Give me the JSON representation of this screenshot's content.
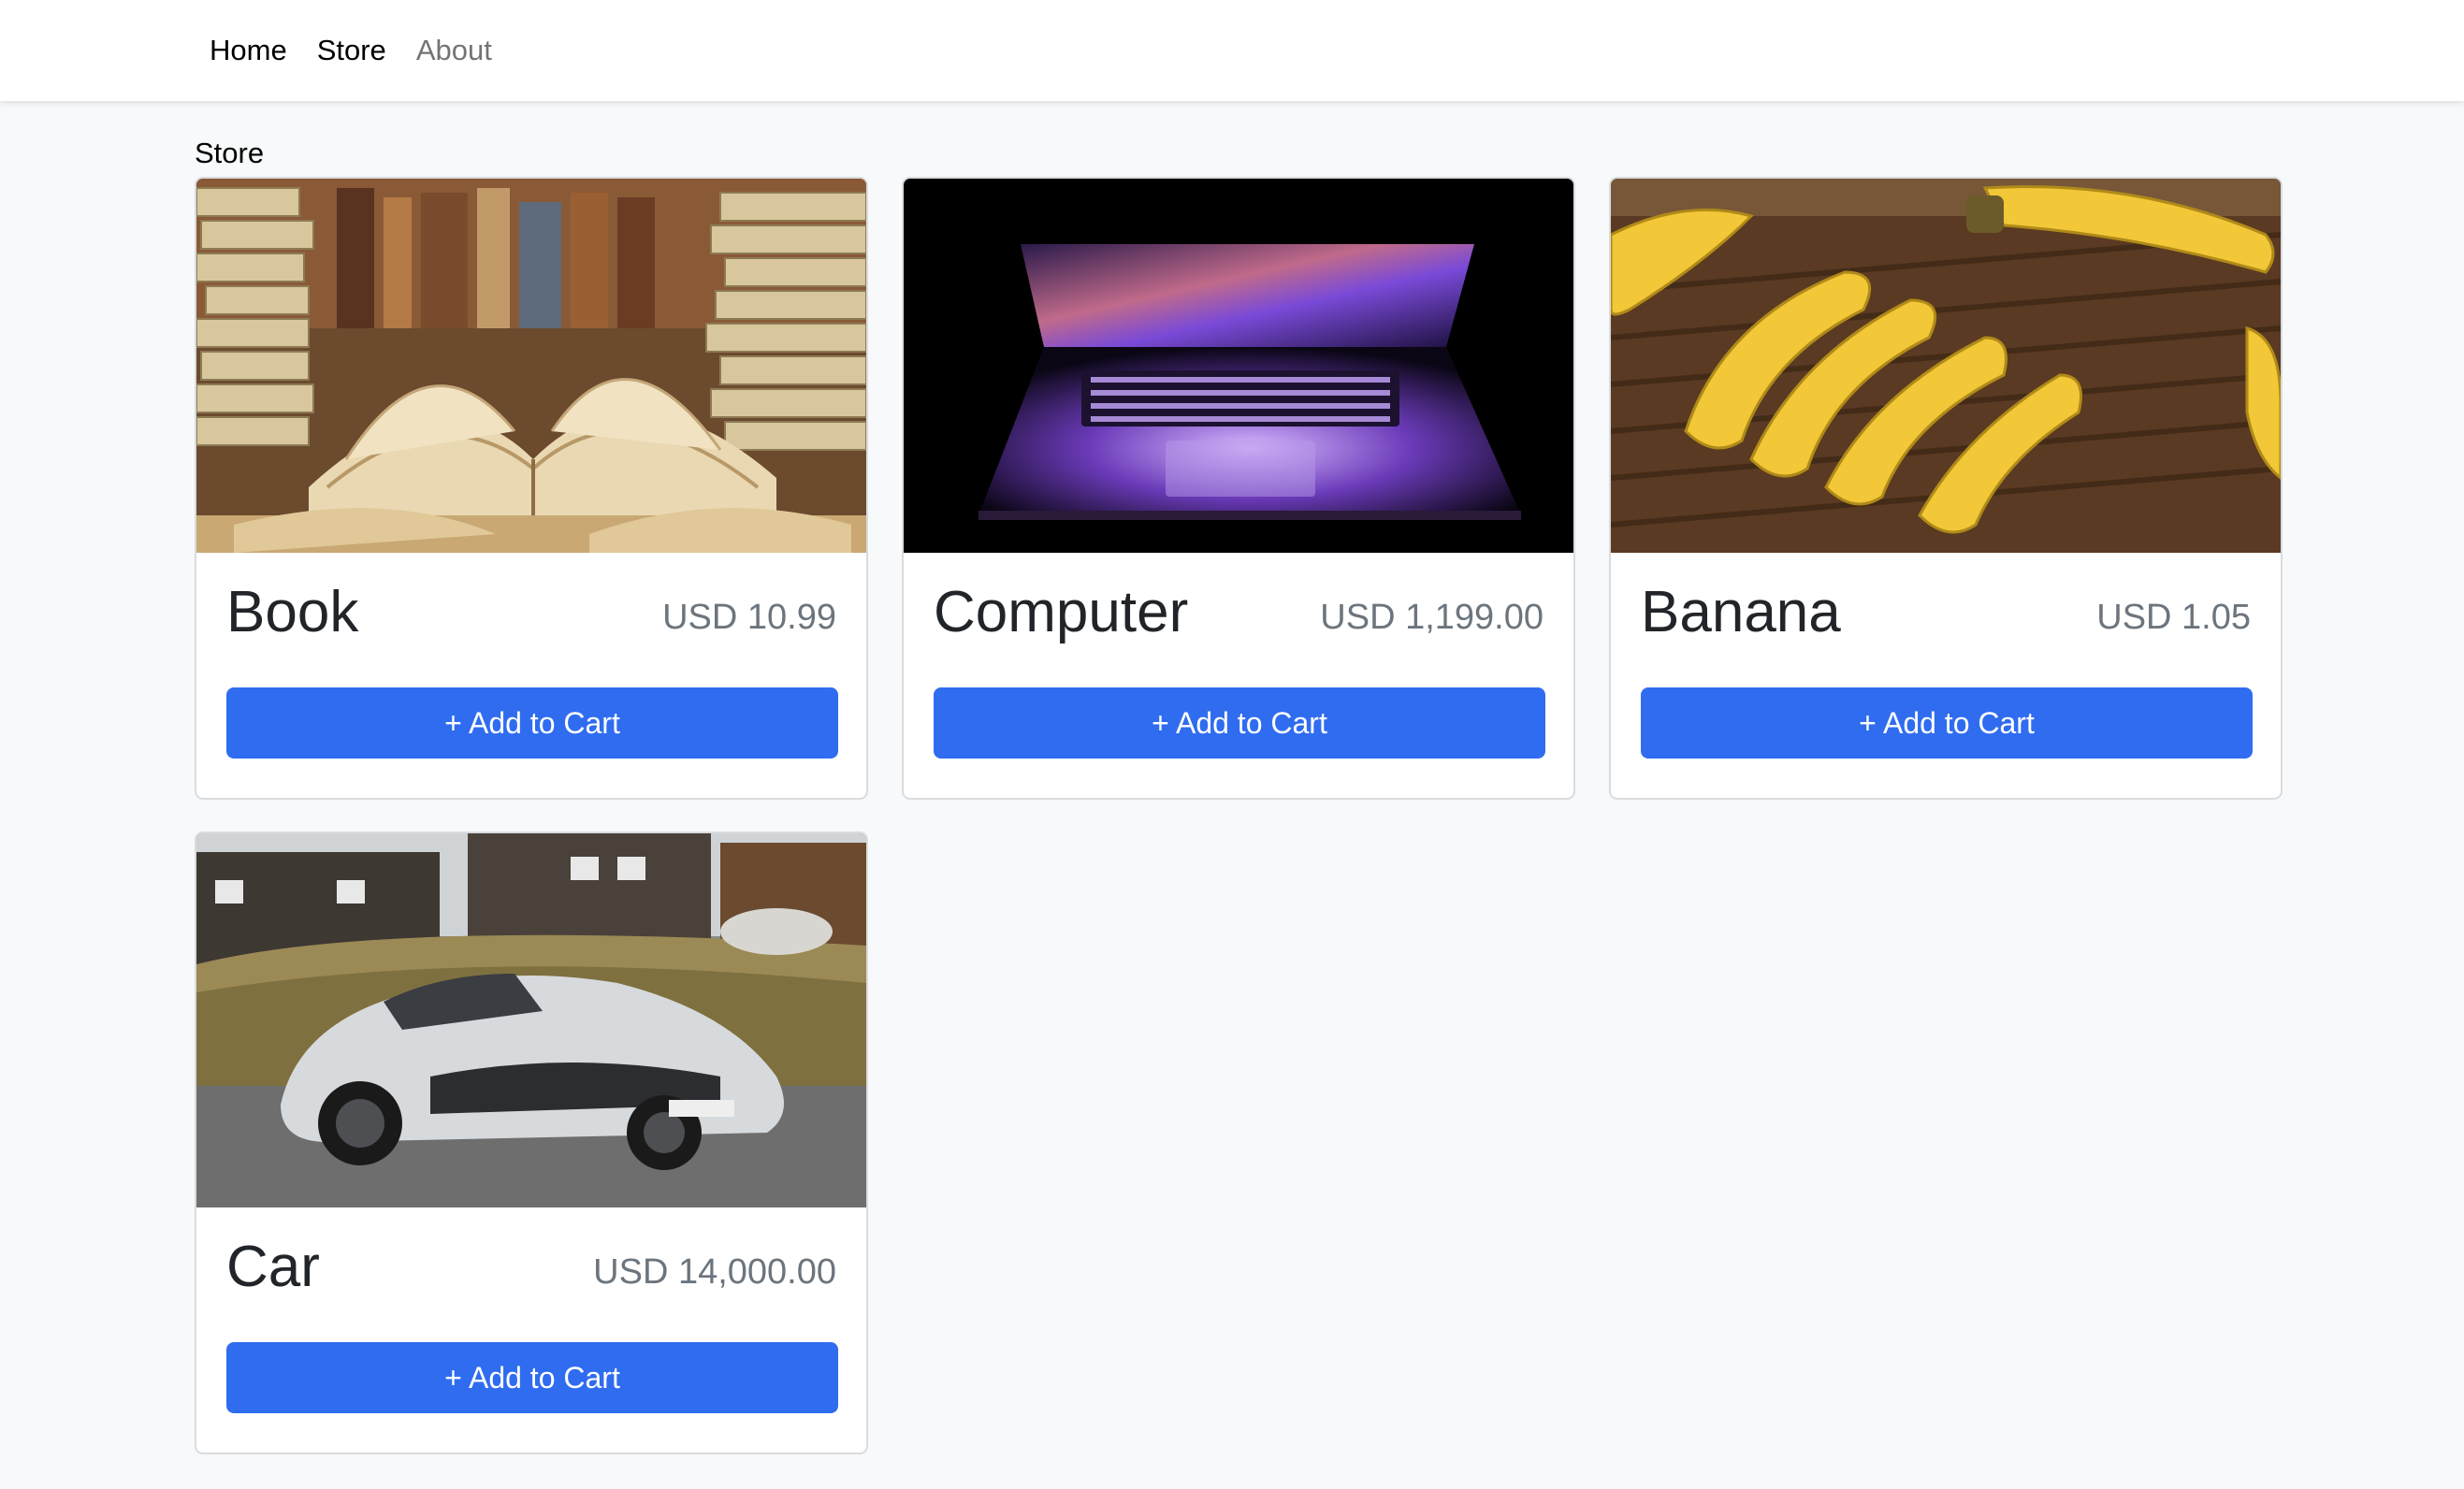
{
  "nav": {
    "links": [
      {
        "label": "Home",
        "active": true
      },
      {
        "label": "Store",
        "active": true
      },
      {
        "label": "About",
        "active": false
      }
    ]
  },
  "page": {
    "heading": "Store"
  },
  "products": [
    {
      "name": "Book",
      "price": "USD 10.99",
      "button": "+ Add to Cart",
      "image": "open-book-stack"
    },
    {
      "name": "Computer",
      "price": "USD 1,199.00",
      "button": "+ Add to Cart",
      "image": "laptop-dark"
    },
    {
      "name": "Banana",
      "price": "USD 1.05",
      "button": "+ Add to Cart",
      "image": "banana-bunch"
    },
    {
      "name": "Car",
      "price": "USD 14,000.00",
      "button": "+ Add to Cart",
      "image": "silver-sports-car"
    }
  ],
  "colors": {
    "primary": "#2f6cf0",
    "price": "#6c757d",
    "background": "#f8f9fa"
  }
}
